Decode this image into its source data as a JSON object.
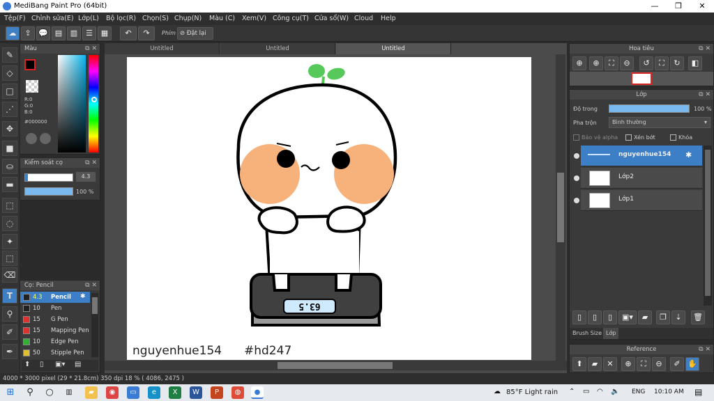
{
  "window": {
    "title": "MediBang Paint Pro (64bit)",
    "min": "—",
    "max": "❐",
    "close": "✕"
  },
  "menu": [
    "Tệp(F)",
    "Chỉnh sửa(E)",
    "Lớp(L)",
    "Bộ lọc(R)",
    "Chọn(S)",
    "Chụp(N)",
    "Màu (C)",
    "Xem(V)",
    "Công cụ(T)",
    "Cửa sổ(W)",
    "Cloud",
    "Help"
  ],
  "toolbar": {
    "key_label": "Phím",
    "reset_label": "Đặt lại"
  },
  "color_panel": {
    "title": "Màu",
    "r": "R:0",
    "g": "G:0",
    "b": "B:0",
    "hex": "#000000",
    "primary": "#000000",
    "secondary": "#7ab8f0"
  },
  "brush_control": {
    "title": "Kiểm soát cọ",
    "size": "4.3",
    "opacity": "100 %"
  },
  "brush_panel": {
    "title": "Cọ: Pencil",
    "items": [
      {
        "size": "4.3",
        "name": "Pencil",
        "color": "#222222"
      },
      {
        "size": "10",
        "name": "Pen",
        "color": "#222222"
      },
      {
        "size": "15",
        "name": "G Pen",
        "color": "#e03030"
      },
      {
        "size": "15",
        "name": "Mapping Pen",
        "color": "#e03030"
      },
      {
        "size": "10",
        "name": "Edge Pen",
        "color": "#30b030"
      },
      {
        "size": "50",
        "name": "Stipple Pen",
        "color": "#e0c030"
      }
    ]
  },
  "tabs": [
    "Untitled",
    "Untitled",
    "Untitled"
  ],
  "canvas": {
    "signature": "nguyenhue154",
    "tag": "#hd247",
    "scale_text": "63.5"
  },
  "navigator": {
    "title": "Hoa tiêu"
  },
  "layers_panel": {
    "title": "Lớp",
    "opacity_label": "Độ trong",
    "opacity_value": "100 %",
    "blend_label": "Pha trộn",
    "blend_value": "Bình thường",
    "protect_alpha": "Bảo vệ alpha",
    "clip": "Xén bớt",
    "lock": "Khóa",
    "layers": [
      {
        "name": "nguyenhue154"
      },
      {
        "name": "Lớp2"
      },
      {
        "name": "Lớp1"
      }
    ],
    "tab_brush_size": "Brush Size",
    "tab_layer": "Lớp"
  },
  "reference": {
    "title": "Reference"
  },
  "status": {
    "text": "4000 * 3000 pixel   (29 * 21.8cm)   350 dpi   18 %   ( 4086, 2475 )"
  },
  "taskbar": {
    "weather": "85°F  Light rain",
    "lang": "ENG",
    "time": "10:10 AM"
  }
}
